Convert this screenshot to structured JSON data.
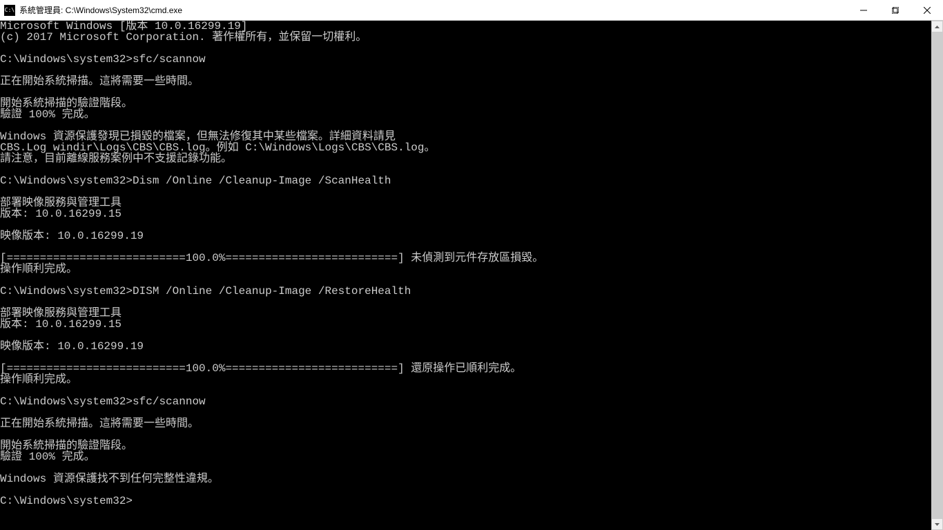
{
  "titlebar": {
    "icon_label": "C:\\",
    "title": "系統管理員: C:\\Windows\\System32\\cmd.exe"
  },
  "console": {
    "lines": [
      "Microsoft Windows [版本 10.0.16299.19]",
      "(c) 2017 Microsoft Corporation. 著作權所有，並保留一切權利。",
      "",
      "C:\\Windows\\system32>sfc/scannow",
      "",
      "正在開始系統掃描。這將需要一些時間。",
      "",
      "開始系統掃描的驗證階段。",
      "驗證 100% 完成。",
      "",
      "Windows 資源保護發現已損毀的檔案，但無法修復其中某些檔案。詳細資料請見",
      "CBS.Log windir\\Logs\\CBS\\CBS.log。例如 C:\\Windows\\Logs\\CBS\\CBS.log。",
      "請注意，目前離線服務案例中不支援記錄功能。",
      "",
      "C:\\Windows\\system32>Dism /Online /Cleanup-Image /ScanHealth",
      "",
      "部署映像服務與管理工具",
      "版本: 10.0.16299.15",
      "",
      "映像版本: 10.0.16299.19",
      "",
      "[===========================100.0%==========================] 未偵測到元件存放區損毀。",
      "操作順利完成。",
      "",
      "C:\\Windows\\system32>DISM /Online /Cleanup-Image /RestoreHealth",
      "",
      "部署映像服務與管理工具",
      "版本: 10.0.16299.15",
      "",
      "映像版本: 10.0.16299.19",
      "",
      "[===========================100.0%==========================] 還原操作已順利完成。",
      "操作順利完成。",
      "",
      "C:\\Windows\\system32>sfc/scannow",
      "",
      "正在開始系統掃描。這將需要一些時間。",
      "",
      "開始系統掃描的驗證階段。",
      "驗證 100% 完成。",
      "",
      "Windows 資源保護找不到任何完整性違規。",
      "",
      "C:\\Windows\\system32>"
    ]
  }
}
